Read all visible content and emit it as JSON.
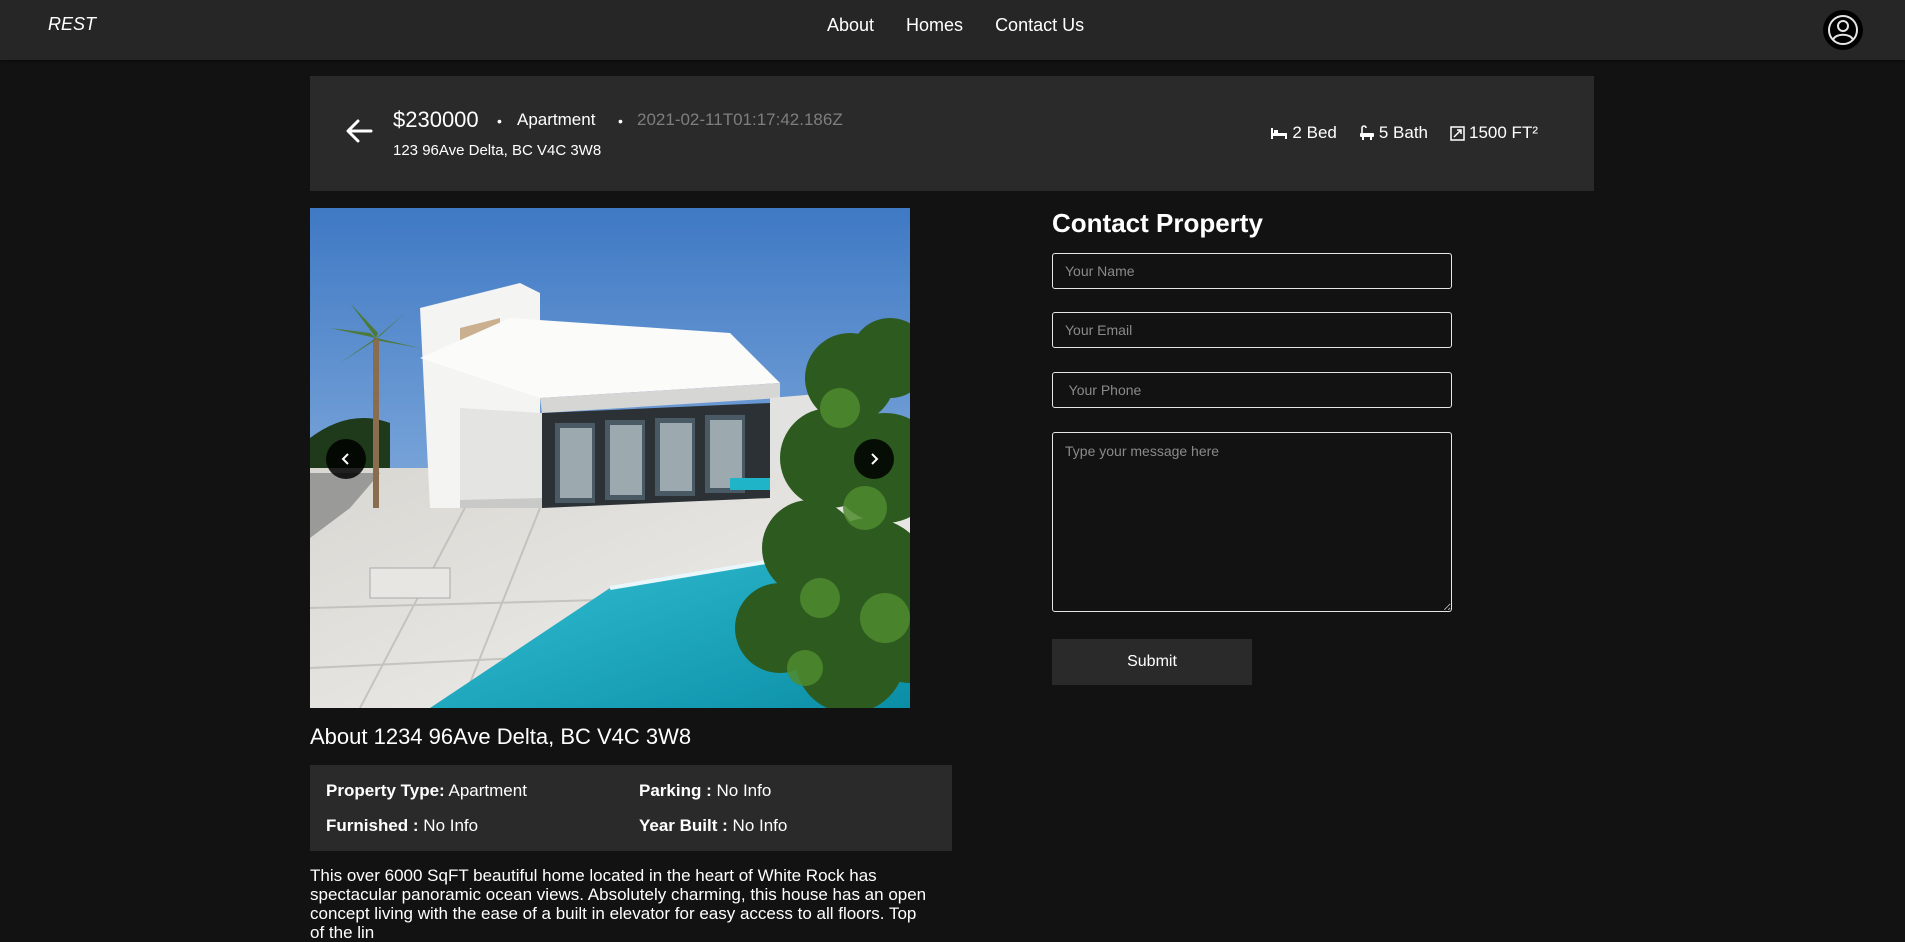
{
  "nav": {
    "brand": "REST",
    "links": [
      "About",
      "Homes",
      "Contact Us"
    ]
  },
  "listing": {
    "price": "$230000",
    "separator": "•",
    "type": "Apartment",
    "date": "2021-02-11T01:17:42.186Z",
    "address": "123 96Ave Delta, BC V4C 3W8",
    "beds": "2 Bed",
    "baths": "5 Bath",
    "area": "1500 FT²"
  },
  "about": {
    "title": "About 1234 96Ave Delta, BC V4C 3W8",
    "property_type_label": "Property Type:",
    "property_type_value": "Apartment",
    "parking_label": "Parking :",
    "parking_value": "No Info",
    "furnished_label": "Furnished :",
    "furnished_value": "No Info",
    "year_built_label": "Year Built :",
    "year_built_value": "No Info",
    "description": "This over 6000 SqFT beautiful home located in the heart of White Rock has spectacular panoramic ocean views. Absolutely charming, this house has an open concept living with the ease of a built in elevator for easy access to all floors. Top of the lin"
  },
  "contact": {
    "title": "Contact Property",
    "name_placeholder": "Your Name",
    "email_placeholder": "Your Email",
    "phone_placeholder": " Your Phone",
    "message_placeholder": "Type your message here",
    "submit_label": "Submit"
  },
  "icons": {
    "back": "arrow-left-icon",
    "bed": "bed-icon",
    "bath": "bathtub-icon",
    "area": "area-icon",
    "user": "user-icon",
    "prev": "chevron-left-icon",
    "next": "chevron-right-icon"
  }
}
